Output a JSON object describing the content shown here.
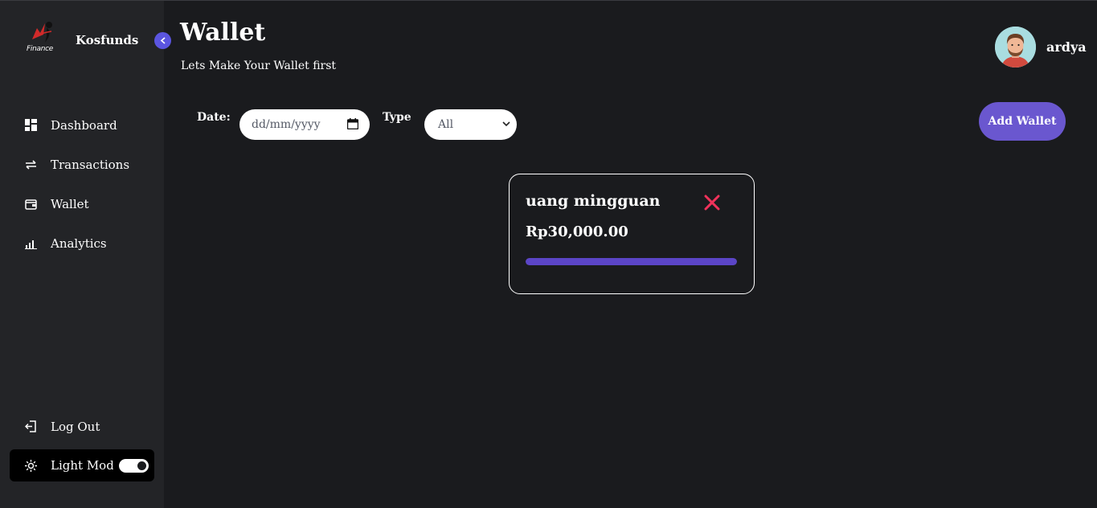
{
  "sidebar": {
    "logo_text": "Finance",
    "brand_name": "Kosfunds",
    "collapse_icon": "chevron-left-icon",
    "items": [
      {
        "label": "Dashboard",
        "icon": "dashboard-icon"
      },
      {
        "label": "Transactions",
        "icon": "swap-arrows-icon"
      },
      {
        "label": "Wallet",
        "icon": "wallet-icon"
      },
      {
        "label": "Analytics",
        "icon": "bar-chart-icon"
      }
    ],
    "logout_label": "Log Out",
    "theme_label": "Light Mode",
    "theme_toggle_on": true
  },
  "header": {
    "title": "Wallet",
    "subtitle": "Lets Make Your Wallet first",
    "username": "ardya"
  },
  "filters": {
    "date_label": "Date:",
    "date_placeholder": "dd/mm/yyyy",
    "type_label": "Type",
    "type_value": "All"
  },
  "actions": {
    "add_wallet_label": "Add Wallet"
  },
  "wallets": [
    {
      "name": "uang mingguan",
      "amount": "Rp30,000.00",
      "progress": 1.0
    }
  ],
  "colors": {
    "accent": "#6a57cf",
    "progress": "#5b45c7",
    "delete": "#f0325a",
    "sidebar_bg": "#232427",
    "main_bg": "#1a1b1e"
  }
}
